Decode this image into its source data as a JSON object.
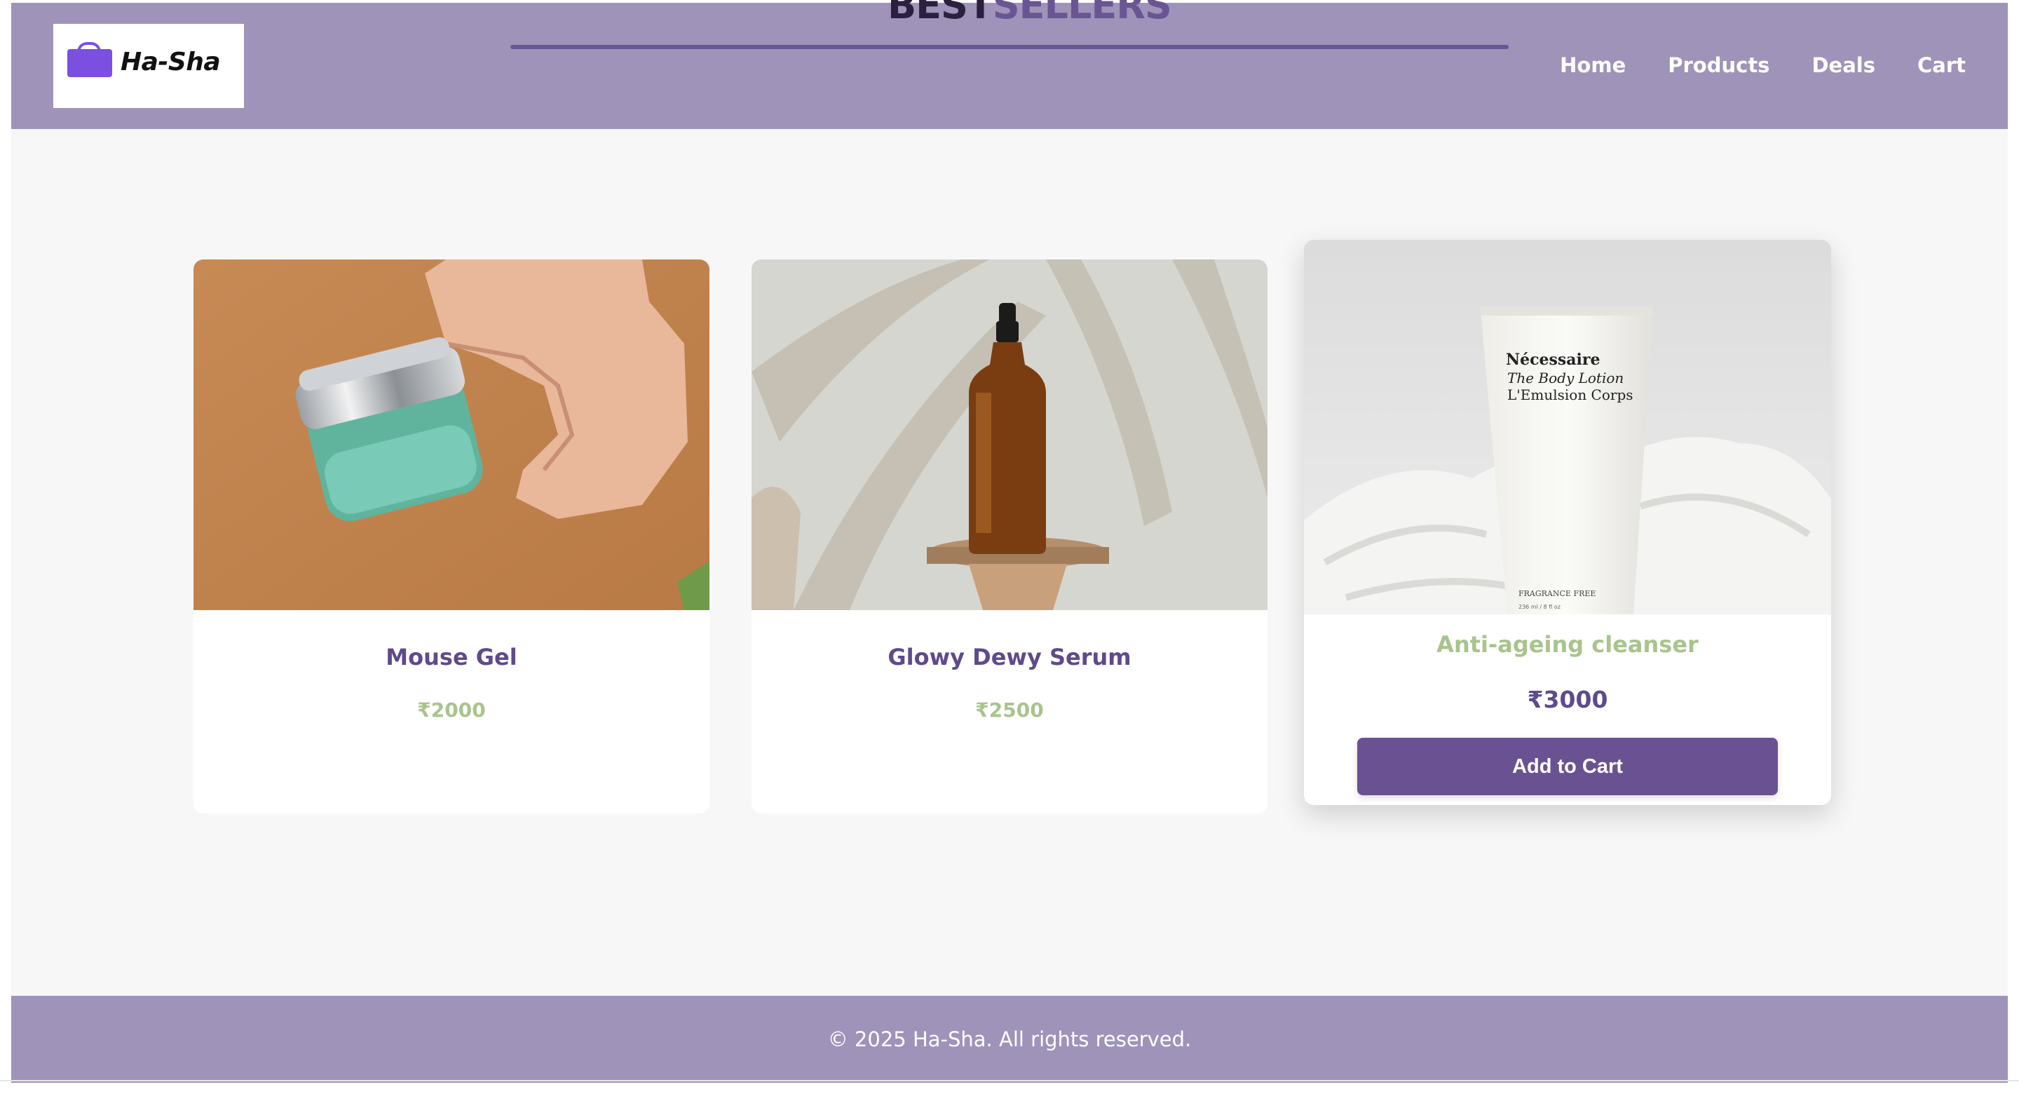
{
  "brand": {
    "logo_text": "Ha-Sha"
  },
  "banner": {
    "title_part1": "BEST",
    "title_part2": "SELLERS"
  },
  "nav": {
    "items": [
      {
        "label": "Home"
      },
      {
        "label": "Products"
      },
      {
        "label": "Deals"
      },
      {
        "label": "Cart"
      }
    ]
  },
  "products": [
    {
      "name": "Mouse Gel",
      "price": "₹2000",
      "image": "gel-jar-in-hand"
    },
    {
      "name": "Glowy Dewy Serum",
      "price": "₹2500",
      "image": "amber-dropper-bottle"
    },
    {
      "name": "Anti-ageing cleanser",
      "price": "₹3000",
      "image": "lotion-tube-on-towel",
      "button_label": "Add to Cart",
      "image_text": {
        "brand": "Nécessaire",
        "line1": "The Body Lotion",
        "line2": "L'Emulsion Corps",
        "note": "FRAGRANCE FREE",
        "volume": "236 ml / 8 fl oz"
      }
    }
  ],
  "footer": {
    "text": "© 2025 Ha-Sha. All rights reserved."
  },
  "colors": {
    "header_bg": "#9f93ba",
    "accent_purple": "#6a5292",
    "accent_green": "#a8c48c",
    "page_bg": "#f7f7f7"
  }
}
